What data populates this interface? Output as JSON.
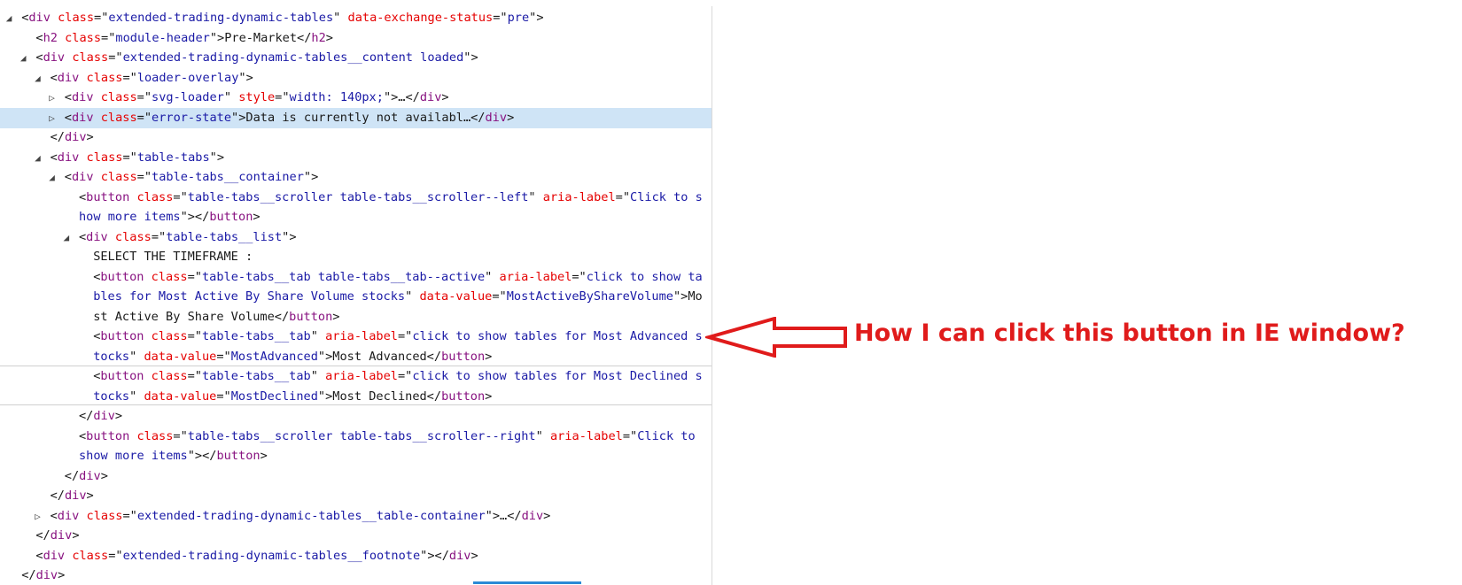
{
  "dom_tree": {
    "lines": [
      {
        "indent": 0,
        "twisty": "◢",
        "parts": [
          [
            "p",
            "<"
          ],
          [
            "t",
            "div"
          ],
          [
            "p",
            " "
          ],
          [
            "a",
            "class"
          ],
          [
            "p",
            "=\""
          ],
          [
            "v",
            "extended-trading-dynamic-tables"
          ],
          [
            "p",
            "\" "
          ],
          [
            "a",
            "data-exchange-status"
          ],
          [
            "p",
            "=\""
          ],
          [
            "v",
            "pre"
          ],
          [
            "p",
            "\">"
          ]
        ]
      },
      {
        "indent": 1,
        "twisty": "",
        "parts": [
          [
            "p",
            "<"
          ],
          [
            "t",
            "h2"
          ],
          [
            "p",
            " "
          ],
          [
            "a",
            "class"
          ],
          [
            "p",
            "=\""
          ],
          [
            "v",
            "module-header"
          ],
          [
            "p",
            "\">Pre-Market</"
          ],
          [
            "t",
            "h2"
          ],
          [
            "p",
            ">"
          ]
        ]
      },
      {
        "indent": 1,
        "twisty": "◢",
        "parts": [
          [
            "p",
            "<"
          ],
          [
            "t",
            "div"
          ],
          [
            "p",
            " "
          ],
          [
            "a",
            "class"
          ],
          [
            "p",
            "=\""
          ],
          [
            "v",
            "extended-trading-dynamic-tables__content loaded"
          ],
          [
            "p",
            "\">"
          ]
        ]
      },
      {
        "indent": 2,
        "twisty": "◢",
        "parts": [
          [
            "p",
            "<"
          ],
          [
            "t",
            "div"
          ],
          [
            "p",
            " "
          ],
          [
            "a",
            "class"
          ],
          [
            "p",
            "=\""
          ],
          [
            "v",
            "loader-overlay"
          ],
          [
            "p",
            "\">"
          ]
        ]
      },
      {
        "indent": 3,
        "twisty": "▷",
        "parts": [
          [
            "p",
            "<"
          ],
          [
            "t",
            "div"
          ],
          [
            "p",
            " "
          ],
          [
            "a",
            "class"
          ],
          [
            "p",
            "=\""
          ],
          [
            "v",
            "svg-loader"
          ],
          [
            "p",
            "\" "
          ],
          [
            "a",
            "style"
          ],
          [
            "p",
            "=\""
          ],
          [
            "v",
            "width: 140px;"
          ],
          [
            "p",
            "\">…</"
          ],
          [
            "t",
            "div"
          ],
          [
            "p",
            ">"
          ]
        ]
      },
      {
        "indent": 3,
        "twisty": "▷",
        "selected": true,
        "parts": [
          [
            "p",
            "<"
          ],
          [
            "t",
            "div"
          ],
          [
            "p",
            " "
          ],
          [
            "a",
            "class"
          ],
          [
            "p",
            "=\""
          ],
          [
            "v",
            "error-state"
          ],
          [
            "p",
            "\">Data is currently not availabl…</"
          ],
          [
            "t",
            "div"
          ],
          [
            "p",
            ">"
          ]
        ]
      },
      {
        "indent": 2,
        "twisty": "",
        "parts": [
          [
            "p",
            "</"
          ],
          [
            "t",
            "div"
          ],
          [
            "p",
            ">"
          ]
        ]
      },
      {
        "indent": 2,
        "twisty": "◢",
        "parts": [
          [
            "p",
            "<"
          ],
          [
            "t",
            "div"
          ],
          [
            "p",
            " "
          ],
          [
            "a",
            "class"
          ],
          [
            "p",
            "=\""
          ],
          [
            "v",
            "table-tabs"
          ],
          [
            "p",
            "\">"
          ]
        ]
      },
      {
        "indent": 3,
        "twisty": "◢",
        "parts": [
          [
            "p",
            "<"
          ],
          [
            "t",
            "div"
          ],
          [
            "p",
            " "
          ],
          [
            "a",
            "class"
          ],
          [
            "p",
            "=\""
          ],
          [
            "v",
            "table-tabs__container"
          ],
          [
            "p",
            "\">"
          ]
        ]
      },
      {
        "indent": 4,
        "twisty": "",
        "parts": [
          [
            "p",
            "<"
          ],
          [
            "t",
            "button"
          ],
          [
            "p",
            " "
          ],
          [
            "a",
            "class"
          ],
          [
            "p",
            "=\""
          ],
          [
            "v",
            "table-tabs__scroller table-tabs__scroller--left"
          ],
          [
            "p",
            "\" "
          ],
          [
            "a",
            "aria-label"
          ],
          [
            "p",
            "=\""
          ],
          [
            "v",
            "Click to s"
          ]
        ]
      },
      {
        "indent": 4,
        "twisty": "",
        "parts": [
          [
            "v",
            "how more items"
          ],
          [
            "p",
            "\"></"
          ],
          [
            "t",
            "button"
          ],
          [
            "p",
            ">"
          ]
        ]
      },
      {
        "indent": 4,
        "twisty": "◢",
        "parts": [
          [
            "p",
            "<"
          ],
          [
            "t",
            "div"
          ],
          [
            "p",
            " "
          ],
          [
            "a",
            "class"
          ],
          [
            "p",
            "=\""
          ],
          [
            "v",
            "table-tabs__list"
          ],
          [
            "p",
            "\">"
          ]
        ]
      },
      {
        "indent": 5,
        "twisty": "",
        "parts": [
          [
            "p",
            "SELECT THE TIMEFRAME :"
          ]
        ]
      },
      {
        "indent": 5,
        "twisty": "",
        "parts": [
          [
            "p",
            "<"
          ],
          [
            "t",
            "button"
          ],
          [
            "p",
            " "
          ],
          [
            "a",
            "class"
          ],
          [
            "p",
            "=\""
          ],
          [
            "v",
            "table-tabs__tab table-tabs__tab--active"
          ],
          [
            "p",
            "\" "
          ],
          [
            "a",
            "aria-label"
          ],
          [
            "p",
            "=\""
          ],
          [
            "v",
            "click to show ta"
          ]
        ]
      },
      {
        "indent": 5,
        "twisty": "",
        "parts": [
          [
            "v",
            "bles for Most Active By Share Volume stocks"
          ],
          [
            "p",
            "\" "
          ],
          [
            "a",
            "data-value"
          ],
          [
            "p",
            "=\""
          ],
          [
            "v",
            "MostActiveByShareVolume"
          ],
          [
            "p",
            "\">Mo"
          ]
        ]
      },
      {
        "indent": 5,
        "twisty": "",
        "parts": [
          [
            "p",
            "st Active By Share Volume</"
          ],
          [
            "t",
            "button"
          ],
          [
            "p",
            ">"
          ]
        ]
      },
      {
        "indent": 5,
        "twisty": "",
        "parts": [
          [
            "p",
            "<"
          ],
          [
            "t",
            "button"
          ],
          [
            "p",
            " "
          ],
          [
            "a",
            "class"
          ],
          [
            "p",
            "=\""
          ],
          [
            "v",
            "table-tabs__tab"
          ],
          [
            "p",
            "\" "
          ],
          [
            "a",
            "aria-label"
          ],
          [
            "p",
            "=\""
          ],
          [
            "v",
            "click to show tables for Most Advanced s"
          ]
        ]
      },
      {
        "indent": 5,
        "twisty": "",
        "parts": [
          [
            "v",
            "tocks"
          ],
          [
            "p",
            "\" "
          ],
          [
            "a",
            "data-value"
          ],
          [
            "p",
            "=\""
          ],
          [
            "v",
            "MostAdvanced"
          ],
          [
            "p",
            "\">Most Advanced</"
          ],
          [
            "t",
            "button"
          ],
          [
            "p",
            ">"
          ]
        ]
      },
      {
        "indent": 5,
        "twisty": "",
        "parts": [
          [
            "p",
            "<"
          ],
          [
            "t",
            "button"
          ],
          [
            "p",
            " "
          ],
          [
            "a",
            "class"
          ],
          [
            "p",
            "=\""
          ],
          [
            "v",
            "table-tabs__tab"
          ],
          [
            "p",
            "\" "
          ],
          [
            "a",
            "aria-label"
          ],
          [
            "p",
            "=\""
          ],
          [
            "v",
            "click to show tables for Most Declined s"
          ]
        ]
      },
      {
        "indent": 5,
        "twisty": "",
        "parts": [
          [
            "v",
            "tocks"
          ],
          [
            "p",
            "\" "
          ],
          [
            "a",
            "data-value"
          ],
          [
            "p",
            "=\""
          ],
          [
            "v",
            "MostDeclined"
          ],
          [
            "p",
            "\">Most Declined</"
          ],
          [
            "t",
            "button"
          ],
          [
            "p",
            ">"
          ]
        ]
      },
      {
        "indent": 4,
        "twisty": "",
        "parts": [
          [
            "p",
            "</"
          ],
          [
            "t",
            "div"
          ],
          [
            "p",
            ">"
          ]
        ]
      },
      {
        "indent": 4,
        "twisty": "",
        "parts": [
          [
            "p",
            "<"
          ],
          [
            "t",
            "button"
          ],
          [
            "p",
            " "
          ],
          [
            "a",
            "class"
          ],
          [
            "p",
            "=\""
          ],
          [
            "v",
            "table-tabs__scroller table-tabs__scroller--right"
          ],
          [
            "p",
            "\" "
          ],
          [
            "a",
            "aria-label"
          ],
          [
            "p",
            "=\""
          ],
          [
            "v",
            "Click to"
          ]
        ]
      },
      {
        "indent": 4,
        "twisty": "",
        "parts": [
          [
            "v",
            "show more items"
          ],
          [
            "p",
            "\"></"
          ],
          [
            "t",
            "button"
          ],
          [
            "p",
            ">"
          ]
        ]
      },
      {
        "indent": 3,
        "twisty": "",
        "parts": [
          [
            "p",
            "</"
          ],
          [
            "t",
            "div"
          ],
          [
            "p",
            ">"
          ]
        ]
      },
      {
        "indent": 2,
        "twisty": "",
        "parts": [
          [
            "p",
            "</"
          ],
          [
            "t",
            "div"
          ],
          [
            "p",
            ">"
          ]
        ]
      },
      {
        "indent": 2,
        "twisty": "▷",
        "parts": [
          [
            "p",
            "<"
          ],
          [
            "t",
            "div"
          ],
          [
            "p",
            " "
          ],
          [
            "a",
            "class"
          ],
          [
            "p",
            "=\""
          ],
          [
            "v",
            "extended-trading-dynamic-tables__table-container"
          ],
          [
            "p",
            "\">…</"
          ],
          [
            "t",
            "div"
          ],
          [
            "p",
            ">"
          ]
        ]
      },
      {
        "indent": 1,
        "twisty": "",
        "parts": [
          [
            "p",
            "</"
          ],
          [
            "t",
            "div"
          ],
          [
            "p",
            ">"
          ]
        ]
      },
      {
        "indent": 1,
        "twisty": "",
        "parts": [
          [
            "p",
            "<"
          ],
          [
            "t",
            "div"
          ],
          [
            "p",
            " "
          ],
          [
            "a",
            "class"
          ],
          [
            "p",
            "=\""
          ],
          [
            "v",
            "extended-trading-dynamic-tables__footnote"
          ],
          [
            "p",
            "\"></"
          ],
          [
            "t",
            "div"
          ],
          [
            "p",
            ">"
          ]
        ]
      },
      {
        "indent": 0,
        "twisty": "",
        "parts": [
          [
            "p",
            "</"
          ],
          [
            "t",
            "div"
          ],
          [
            "p",
            ">"
          ]
        ]
      }
    ]
  },
  "annotation": {
    "text": "How I can click this button in IE window?",
    "color": "#e01b1b"
  },
  "colors": {
    "tag": "#881280",
    "attr_name": "#e50000",
    "attr_value": "#1a1aa6",
    "selected_row": "#cfe4f6"
  }
}
